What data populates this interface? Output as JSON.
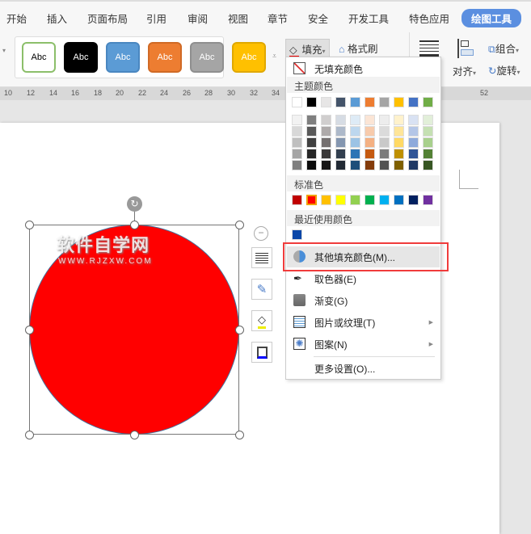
{
  "tabs": [
    "开始",
    "插入",
    "页面布局",
    "引用",
    "审阅",
    "视图",
    "章节",
    "安全",
    "开发工具",
    "特色应用",
    "绘图工具"
  ],
  "ribbon": {
    "style_label": "Abc",
    "fill": "填充",
    "format_painter": "格式刷",
    "align": "对齐",
    "group": "组合",
    "rotate": "旋转"
  },
  "style_colors": [
    {
      "bg": "#ffffff",
      "border": "#8cbf6a",
      "text": "#000"
    },
    {
      "bg": "#000000",
      "border": "#000",
      "text": "#fff"
    },
    {
      "bg": "#5b9bd5",
      "border": "#4a87c0",
      "text": "#fff"
    },
    {
      "bg": "#ed7d31",
      "border": "#d06a25",
      "text": "#fff"
    },
    {
      "bg": "#a5a5a5",
      "border": "#8f8f8f",
      "text": "#fff"
    },
    {
      "bg": "#ffc000",
      "border": "#e0a800",
      "text": "#fff"
    }
  ],
  "ruler": [
    "10",
    "12",
    "14",
    "16",
    "18",
    "20",
    "22",
    "24",
    "26",
    "28",
    "30",
    "32",
    "34",
    "52"
  ],
  "watermark": {
    "title": "软件自学网",
    "url": "WWW.RJZXW.COM"
  },
  "shape": {
    "fill": "#ff0000",
    "outline": "#41719c"
  },
  "menu": {
    "no_fill": "无填充颜色",
    "theme_header": "主题颜色",
    "theme_colors": [
      "#ffffff",
      "#000000",
      "#e7e6e6",
      "#44546a",
      "#5b9bd5",
      "#ed7d31",
      "#a5a5a5",
      "#ffc000",
      "#4472c4",
      "#70ad47"
    ],
    "shades": [
      [
        "#f2f2f2",
        "#7f7f7f",
        "#d0cece",
        "#d6dce4",
        "#deebf6",
        "#fbe5d5",
        "#ededed",
        "#fff2cc",
        "#d9e2f3",
        "#e2efd9"
      ],
      [
        "#d8d8d8",
        "#595959",
        "#aeaaaa",
        "#adb9ca",
        "#bdd7ee",
        "#f7cbac",
        "#dbdbdb",
        "#fee599",
        "#b4c6e7",
        "#c5e0b3"
      ],
      [
        "#bfbfbf",
        "#3f3f3f",
        "#757070",
        "#8496b0",
        "#9cc3e5",
        "#f4b183",
        "#c9c9c9",
        "#ffd965",
        "#8eaadb",
        "#a8d08d"
      ],
      [
        "#a5a5a5",
        "#262626",
        "#3a3838",
        "#323f4f",
        "#2e75b5",
        "#c55a11",
        "#7b7b7b",
        "#bf9000",
        "#2f5496",
        "#538135"
      ],
      [
        "#7f7f7f",
        "#0c0c0c",
        "#171616",
        "#222a35",
        "#1e4e79",
        "#843c0b",
        "#525252",
        "#7f6000",
        "#1f3864",
        "#375623"
      ]
    ],
    "standard_header": "标准色",
    "standard_colors": [
      "#c00000",
      "#ff0000",
      "#ffc000",
      "#ffff00",
      "#92d050",
      "#00b050",
      "#00b0f0",
      "#0070c0",
      "#002060",
      "#7030a0"
    ],
    "recent_header": "最近使用颜色",
    "recent_colors": [
      "#0a47a8"
    ],
    "items": [
      "其他填充颜色(M)...",
      "取色器(E)",
      "渐变(G)",
      "图片或纹理(T)",
      "图案(N)",
      "更多设置(O)..."
    ]
  }
}
